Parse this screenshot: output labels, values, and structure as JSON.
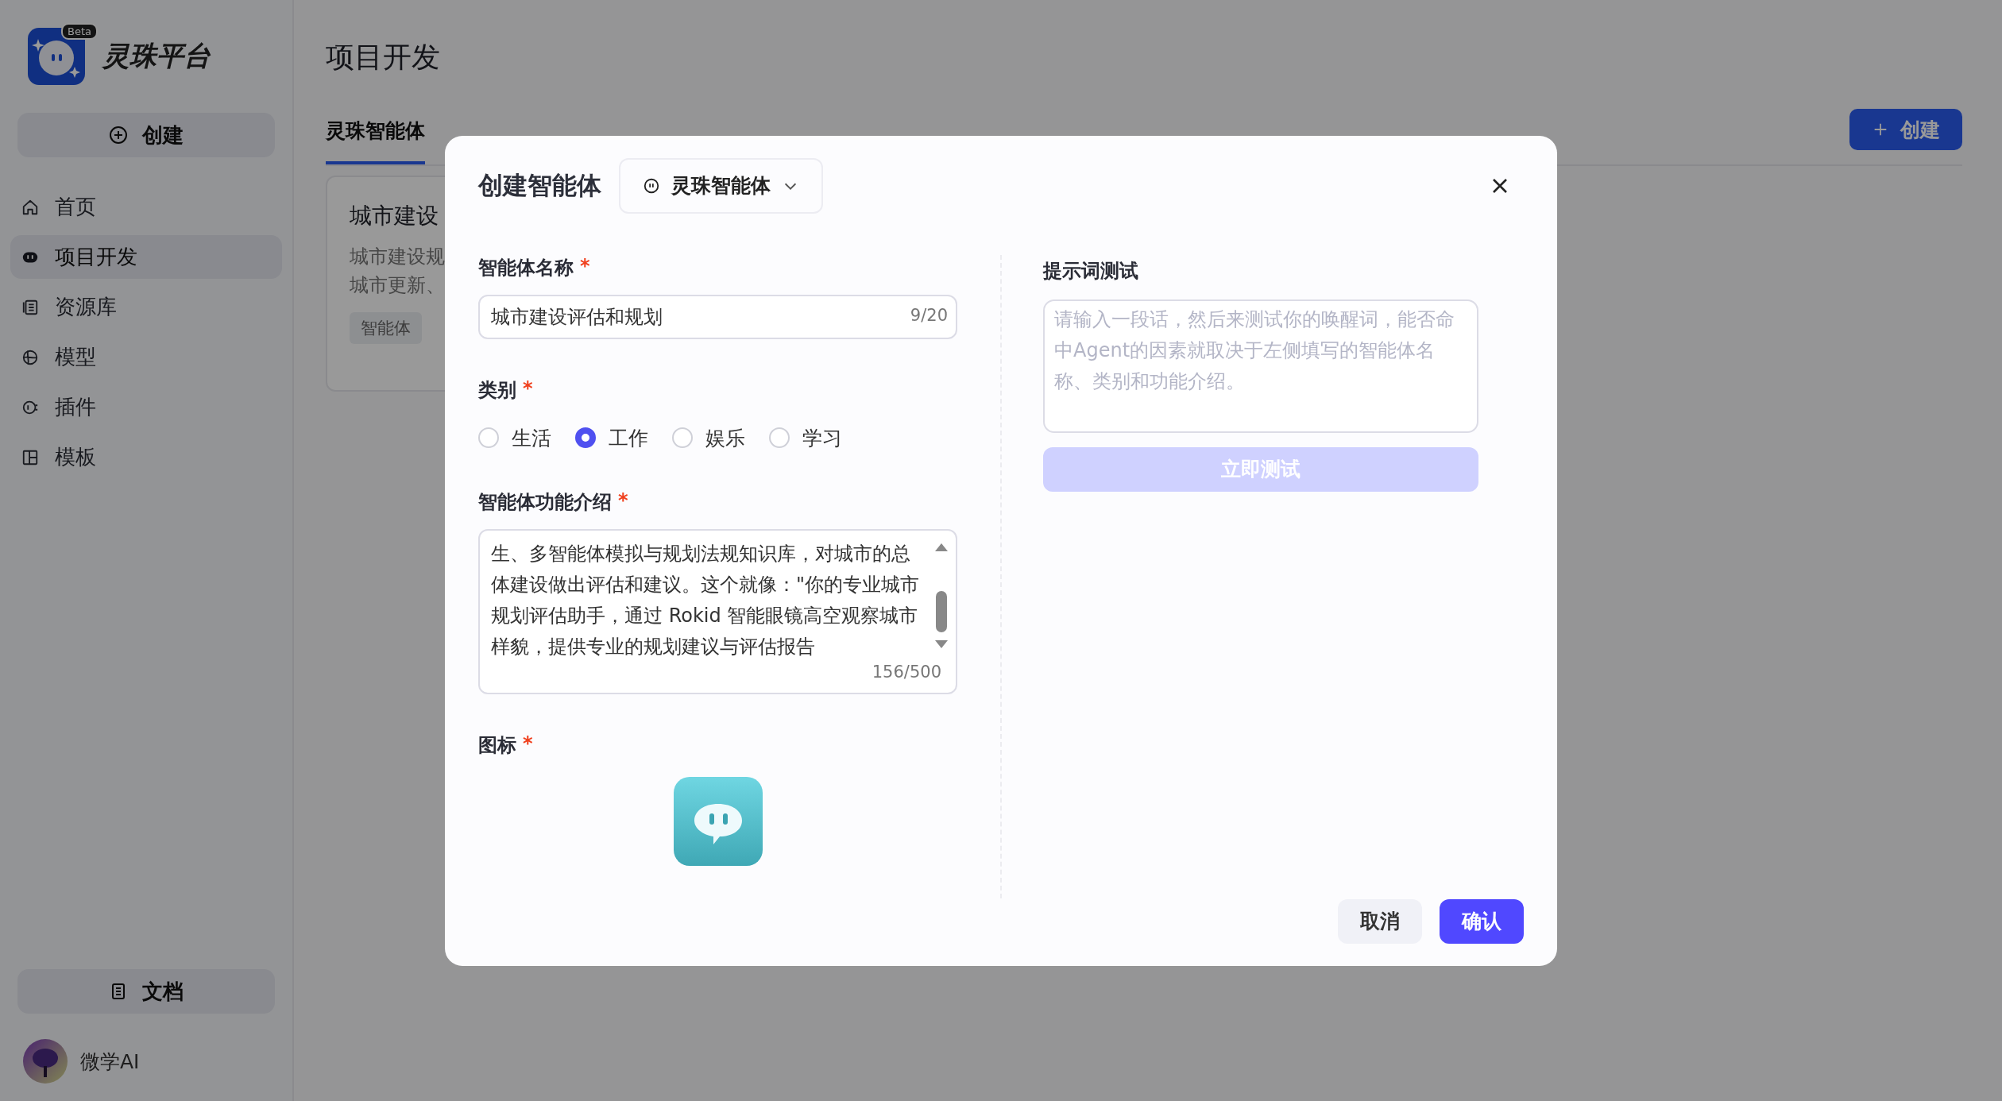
{
  "sidebar": {
    "logo_text": "灵珠平台",
    "badge": "Beta",
    "create_button": "创建",
    "items": [
      {
        "label": "首页",
        "kind": "home",
        "selected": false
      },
      {
        "label": "项目开发",
        "kind": "bot",
        "selected": true
      },
      {
        "label": "资源库",
        "kind": "library",
        "selected": false
      },
      {
        "label": "模型",
        "kind": "model",
        "selected": false
      },
      {
        "label": "插件",
        "kind": "plugin",
        "selected": false
      },
      {
        "label": "模板",
        "kind": "template",
        "selected": false
      }
    ],
    "docs_button": "文档",
    "user": {
      "name": "微学AI"
    }
  },
  "page": {
    "title": "项目开发",
    "tabs": [
      {
        "label": "灵珠智能体",
        "selected": true
      }
    ],
    "create_button": "创建",
    "card": {
      "title": "城市建设",
      "lines": [
        "城市建设规",
        "城市更新、"
      ],
      "tag": "智能体"
    }
  },
  "dialog": {
    "title": "创建智能体",
    "type_select": "灵珠智能体",
    "required_mark": "*",
    "name_label": "智能体名称",
    "name_value": "城市建设评估和规划",
    "name_count": "9/20",
    "category_label": "类别",
    "categories": [
      {
        "label": "生活",
        "selected": false
      },
      {
        "label": "工作",
        "selected": true
      },
      {
        "label": "娱乐",
        "selected": false
      },
      {
        "label": "学习",
        "selected": false
      }
    ],
    "intro_label": "智能体功能介绍",
    "intro_text": "生、多智能体模拟与规划法规知识库，对城市的总体建设做出评估和建议。这个就像：\"你的专业城市规划评估助手，通过 Rokid 智能眼镜高空观察城市样貌，提供专业的规划建议与评估报告",
    "intro_count": "156/500",
    "icon_label": "图标",
    "test_label": "提示词测试",
    "test_placeholder": "请输入一段话，然后来测试你的唤醒词，能否命中Agent的因素就取决于左侧填写的智能体名称、类别和功能介绍。",
    "test_button": {
      "label": "立即测试",
      "disabled": true
    },
    "cancel": "取消",
    "confirm": "确认"
  }
}
